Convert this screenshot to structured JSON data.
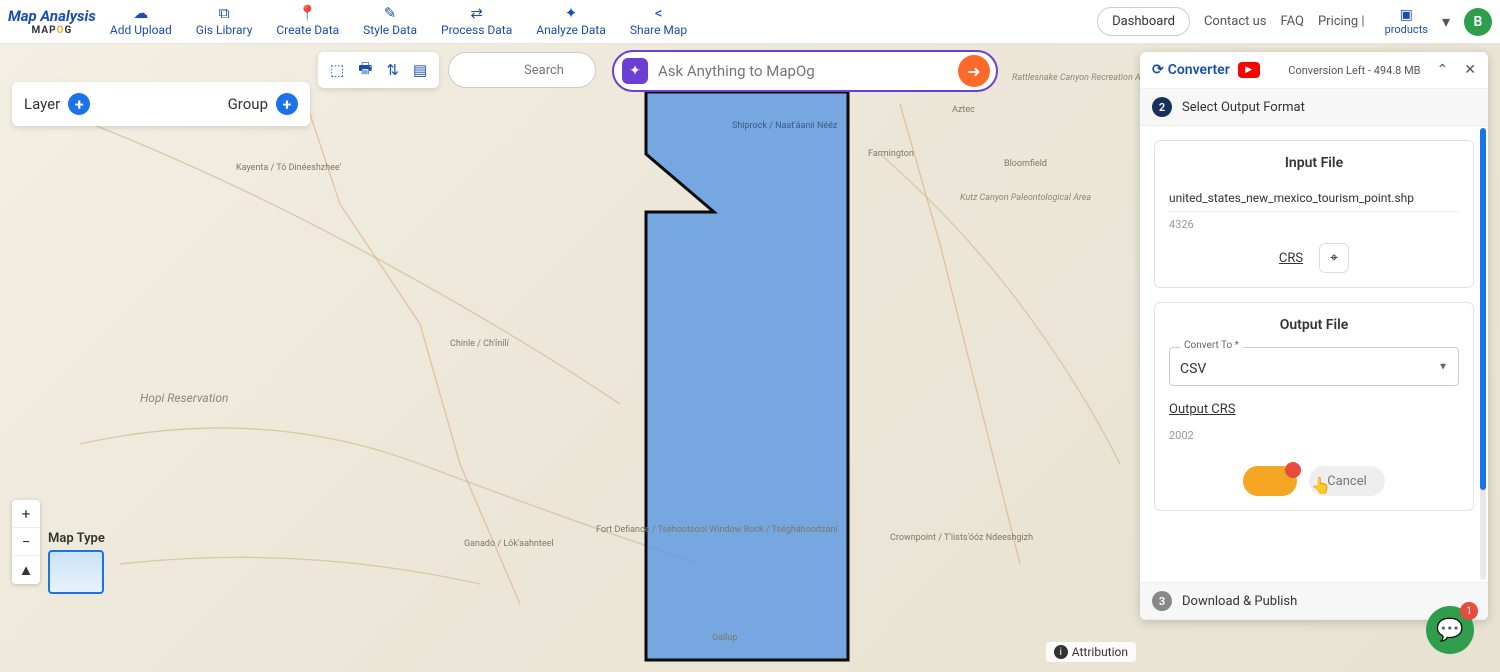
{
  "brand": {
    "title": "Map Analysis",
    "sub_left": "MAP",
    "sub_right": "G"
  },
  "nav": {
    "items": [
      {
        "icon": "☁",
        "label": "Add Upload"
      },
      {
        "icon": "⧉",
        "label": "Gis Library"
      },
      {
        "icon": "📍",
        "label": "Create Data"
      },
      {
        "icon": "✎",
        "label": "Style Data"
      },
      {
        "icon": "⇄",
        "label": "Process Data"
      },
      {
        "icon": "✦",
        "label": "Analyze Data"
      },
      {
        "icon": "<",
        "label": "Share Map"
      }
    ],
    "dashboard": "Dashboard",
    "right_links": [
      "Contact us",
      "FAQ",
      "Pricing |"
    ],
    "products": "products",
    "avatar": "B"
  },
  "layer_panel": {
    "layer": "Layer",
    "group": "Group"
  },
  "toolbar": {
    "tools": [
      "⬚",
      "🖶",
      "⇅",
      "▤"
    ]
  },
  "search": {
    "placeholder": "Search"
  },
  "ask": {
    "placeholder": "Ask Anything to MapOg"
  },
  "converter": {
    "title": "Converter",
    "meta": "Conversion Left - 494.8 MB",
    "step2": {
      "num": "2",
      "title": "Select Output Format"
    },
    "input": {
      "heading": "Input File",
      "filename": "united_states_new_mexico_tourism_point.shp",
      "crs_value": "4326",
      "crs_label": "CRS"
    },
    "output": {
      "heading": "Output File",
      "convert_label": "Convert To *",
      "convert_value": "CSV",
      "output_crs_label": "Output CRS",
      "output_crs_value": "2002"
    },
    "cancel": "Cancel",
    "step3": {
      "num": "3",
      "title": "Download & Publish"
    }
  },
  "map_controls": {
    "maptype_label": "Map Type"
  },
  "attribution": "Attribution",
  "chat_badge": "1",
  "map_labels": {
    "kayenta": "Kayenta /\nTó Dinéeshzhee'",
    "hopi": "Hopi Reservation",
    "chinle": "Chinle / Ch'ínílí",
    "ganado": "Ganado /\nLók'aahnteel",
    "fortdef": "Fort Defiance /\nTséhootsooí\nWindow Rock /\nTségháhoodzání",
    "gallup": "Gallup",
    "shiprock": "Shiprock /\nNaat'áanii\nNééz",
    "farmington": "Farmington",
    "aztec": "Aztec",
    "bloomfield": "Bloomfield",
    "crownpoint": "Crownpoint /\nT'iists'óóz\nNdeeshgizh",
    "kutz": "Kutz Canyon\nPaleontological\nArea",
    "rattlesnake": "Rattlesnake\nCanyon\nRecreation Area"
  }
}
